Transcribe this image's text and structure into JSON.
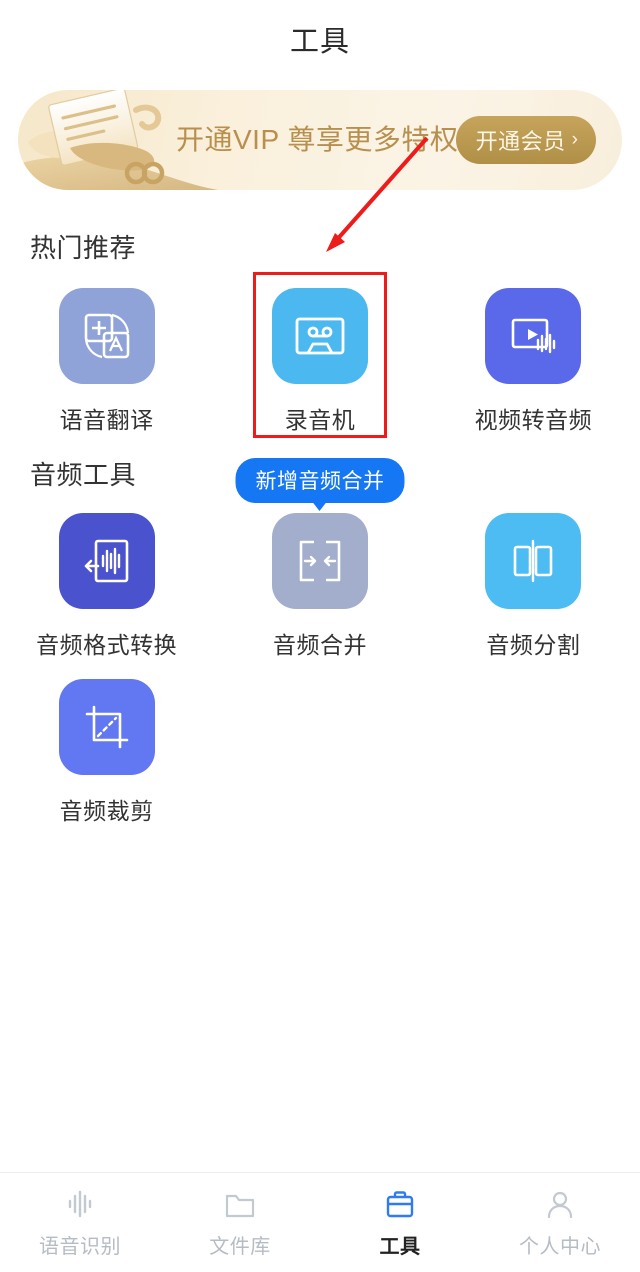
{
  "header": {
    "title": "工具"
  },
  "vip_banner": {
    "text": "开通VIP 尊享更多特权",
    "button_label": "开通会员",
    "chevron": "›",
    "bg_color": "#f8eedc",
    "text_color": "#b98f4e",
    "button_color": "#b99a4f",
    "art_icon": "documents-infinity-illustration"
  },
  "sections": [
    {
      "title": "热门推荐",
      "items": [
        {
          "label": "语音翻译",
          "icon": "translate-icon",
          "color": "#8fa3d8",
          "highlighted": false
        },
        {
          "label": "录音机",
          "icon": "cassette-recorder-icon",
          "color": "#4cb8f0",
          "highlighted": true
        },
        {
          "label": "视频转音频",
          "icon": "video-to-audio-icon",
          "color": "#5a68ea",
          "highlighted": false
        }
      ]
    },
    {
      "title": "音频工具",
      "items": [
        {
          "label": "音频格式转换",
          "icon": "audio-format-convert-icon",
          "color": "#4b52cd",
          "highlighted": false,
          "badge": null
        },
        {
          "label": "音频合并",
          "icon": "audio-merge-icon",
          "color": "#a3aecd",
          "highlighted": false,
          "badge": "新增音频合并"
        },
        {
          "label": "音频分割",
          "icon": "audio-split-icon",
          "color": "#4cbcf2",
          "highlighted": false,
          "badge": null
        },
        {
          "label": "音频裁剪",
          "icon": "audio-crop-icon",
          "color": "#6277f2",
          "highlighted": false,
          "badge": null
        }
      ]
    }
  ],
  "annotation": {
    "color": "#ee1b1b",
    "target": "录音机",
    "shape": "arrow-and-box"
  },
  "tabbar": {
    "active_color": "#2f7bf5",
    "inactive_color": "#b6bcc4",
    "items": [
      {
        "label": "语音识别",
        "icon": "waveform-icon",
        "active": false
      },
      {
        "label": "文件库",
        "icon": "folder-icon",
        "active": false
      },
      {
        "label": "工具",
        "icon": "briefcase-icon",
        "active": true
      },
      {
        "label": "个人中心",
        "icon": "person-icon",
        "active": false
      }
    ]
  }
}
